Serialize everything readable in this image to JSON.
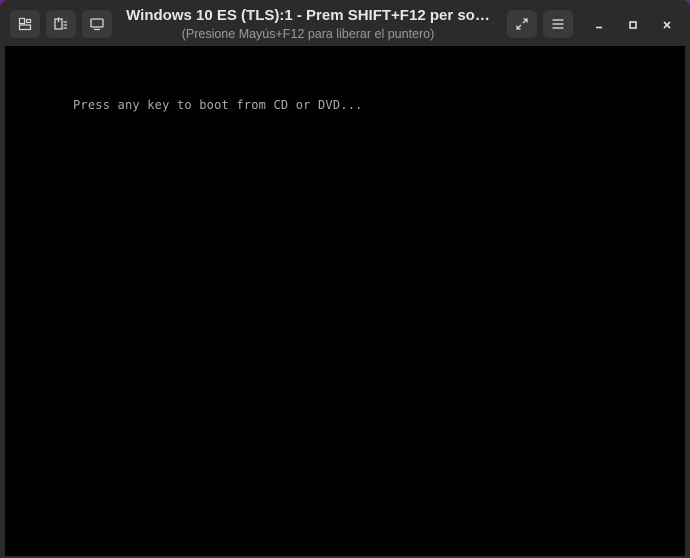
{
  "window": {
    "title": "Windows 10 ES (TLS):1 - Prem SHIFT+F12 per so…",
    "subtitle": "(Presione Mayús+F12 para liberar el  puntero)"
  },
  "toolbar": {
    "icons": [
      "snapshot-icon",
      "usb-redirect-icon",
      "display-icon"
    ]
  },
  "controls": {
    "icons": [
      "fullscreen-icon",
      "menu-icon",
      "minimize-icon",
      "maximize-icon",
      "close-icon"
    ]
  },
  "vm_screen": {
    "boot_message": "Press any key to boot from CD or DVD..."
  },
  "colors": {
    "titlebar": "#2b2b2b",
    "button": "#3a3a3a",
    "screen": "#000000",
    "boot_text": "#aaaaaa",
    "desktop": "#5b2a86"
  }
}
